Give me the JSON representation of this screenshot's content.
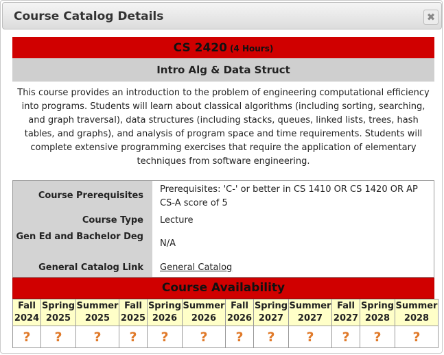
{
  "dialog": {
    "title": "Course Catalog Details"
  },
  "course": {
    "code": "CS 2420",
    "hours": "(4 Hours)",
    "name": "Intro Alg & Data Struct",
    "description": "This course provides an introduction to the problem of engineering computational efficiency into programs. Students will learn about classical algorithms (including sorting, searching, and graph traversal), data structures (including stacks, queues, linked lists, trees, hash tables, and graphs), and analysis of program space and time requirements. Students will complete extensive programming exercises that require the application of elementary techniques from software engineering."
  },
  "info": {
    "prereq_label": "Course Prerequisites",
    "prereq_value": "Prerequisites: 'C-' or better in CS 1410 OR CS 1420 OR AP CS-A score of 5",
    "type_label": "Course Type",
    "type_value": "Lecture",
    "gened_label": "Gen Ed and Bachelor Deg",
    "gened_value": "N/A",
    "catalog_label": "General Catalog Link",
    "catalog_link": "General Catalog"
  },
  "availability": {
    "title": "Course Availability",
    "terms": [
      {
        "season": "Fall",
        "year": "2024",
        "status": "?"
      },
      {
        "season": "Spring",
        "year": "2025",
        "status": "?"
      },
      {
        "season": "Summer",
        "year": "2025",
        "status": "?"
      },
      {
        "season": "Fall",
        "year": "2025",
        "status": "?"
      },
      {
        "season": "Spring",
        "year": "2026",
        "status": "?"
      },
      {
        "season": "Summer",
        "year": "2026",
        "status": "?"
      },
      {
        "season": "Fall",
        "year": "2026",
        "status": "?"
      },
      {
        "season": "Spring",
        "year": "2027",
        "status": "?"
      },
      {
        "season": "Summer",
        "year": "2027",
        "status": "?"
      },
      {
        "season": "Fall",
        "year": "2027",
        "status": "?"
      },
      {
        "season": "Spring",
        "year": "2028",
        "status": "?"
      },
      {
        "season": "Summer",
        "year": "2028",
        "status": "?"
      }
    ]
  },
  "colors": {
    "header_red": "#d00000",
    "subheader_gray": "#cfcfcf",
    "term_bg": "#ffffc8",
    "status_orange": "#e07a2a"
  }
}
